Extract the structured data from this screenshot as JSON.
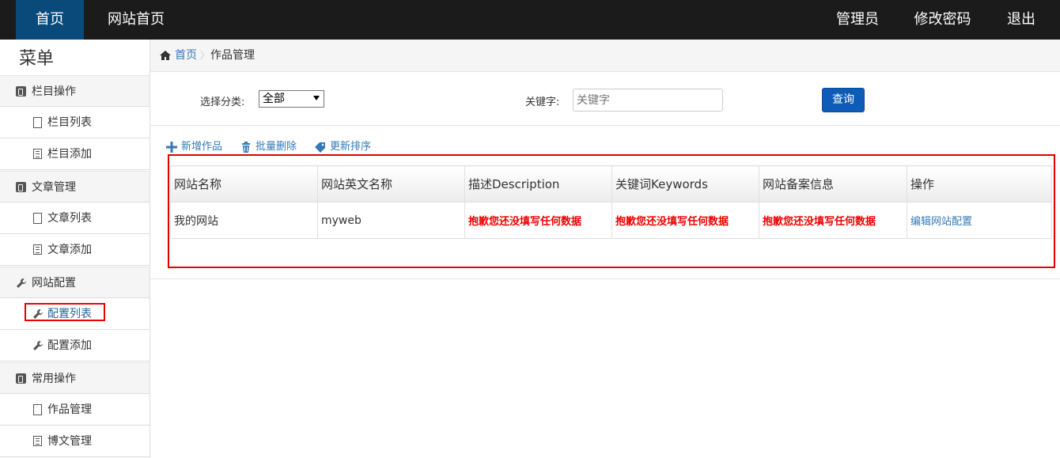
{
  "navbar": {
    "home": "首页",
    "site_home": "网站首页",
    "admin": "管理员",
    "change_password": "修改密码",
    "logout": "退出"
  },
  "sidebar": {
    "title": "菜单",
    "groups": [
      {
        "label": "栏目操作",
        "items": [
          "栏目列表",
          "栏目添加"
        ]
      },
      {
        "label": "文章管理",
        "items": [
          "文章列表",
          "文章添加"
        ]
      },
      {
        "label": "网站配置",
        "items": [
          "配置列表",
          "配置添加"
        ]
      },
      {
        "label": "常用操作",
        "items": [
          "作品管理",
          "博文管理"
        ]
      }
    ]
  },
  "breadcrumb": {
    "home": "首页",
    "current": "作品管理"
  },
  "filter": {
    "category_label": "选择分类:",
    "category_value": "全部",
    "keyword_label": "关键字:",
    "keyword_placeholder": "关键字",
    "query_button": "查询"
  },
  "actions": {
    "add": "新增作品",
    "batch_delete": "批量删除",
    "update_sort": "更新排序"
  },
  "table": {
    "headers": [
      "网站名称",
      "网站英文名称",
      "描述Description",
      "关键词Keywords",
      "网站备案信息",
      "操作"
    ],
    "rows": [
      [
        "我的网站",
        "myweb",
        "抱歉您还没填写任何数据",
        "抱歉您还没填写任何数据",
        "抱歉您还没填写任何数据",
        "编辑网站配置"
      ]
    ]
  },
  "colors": {
    "navbar_bg": "#1b1b1b",
    "navbar_active": "#0a4a7a",
    "link": "#337ab7",
    "error": "#e00000",
    "primary_button": "#0d5cb8"
  }
}
